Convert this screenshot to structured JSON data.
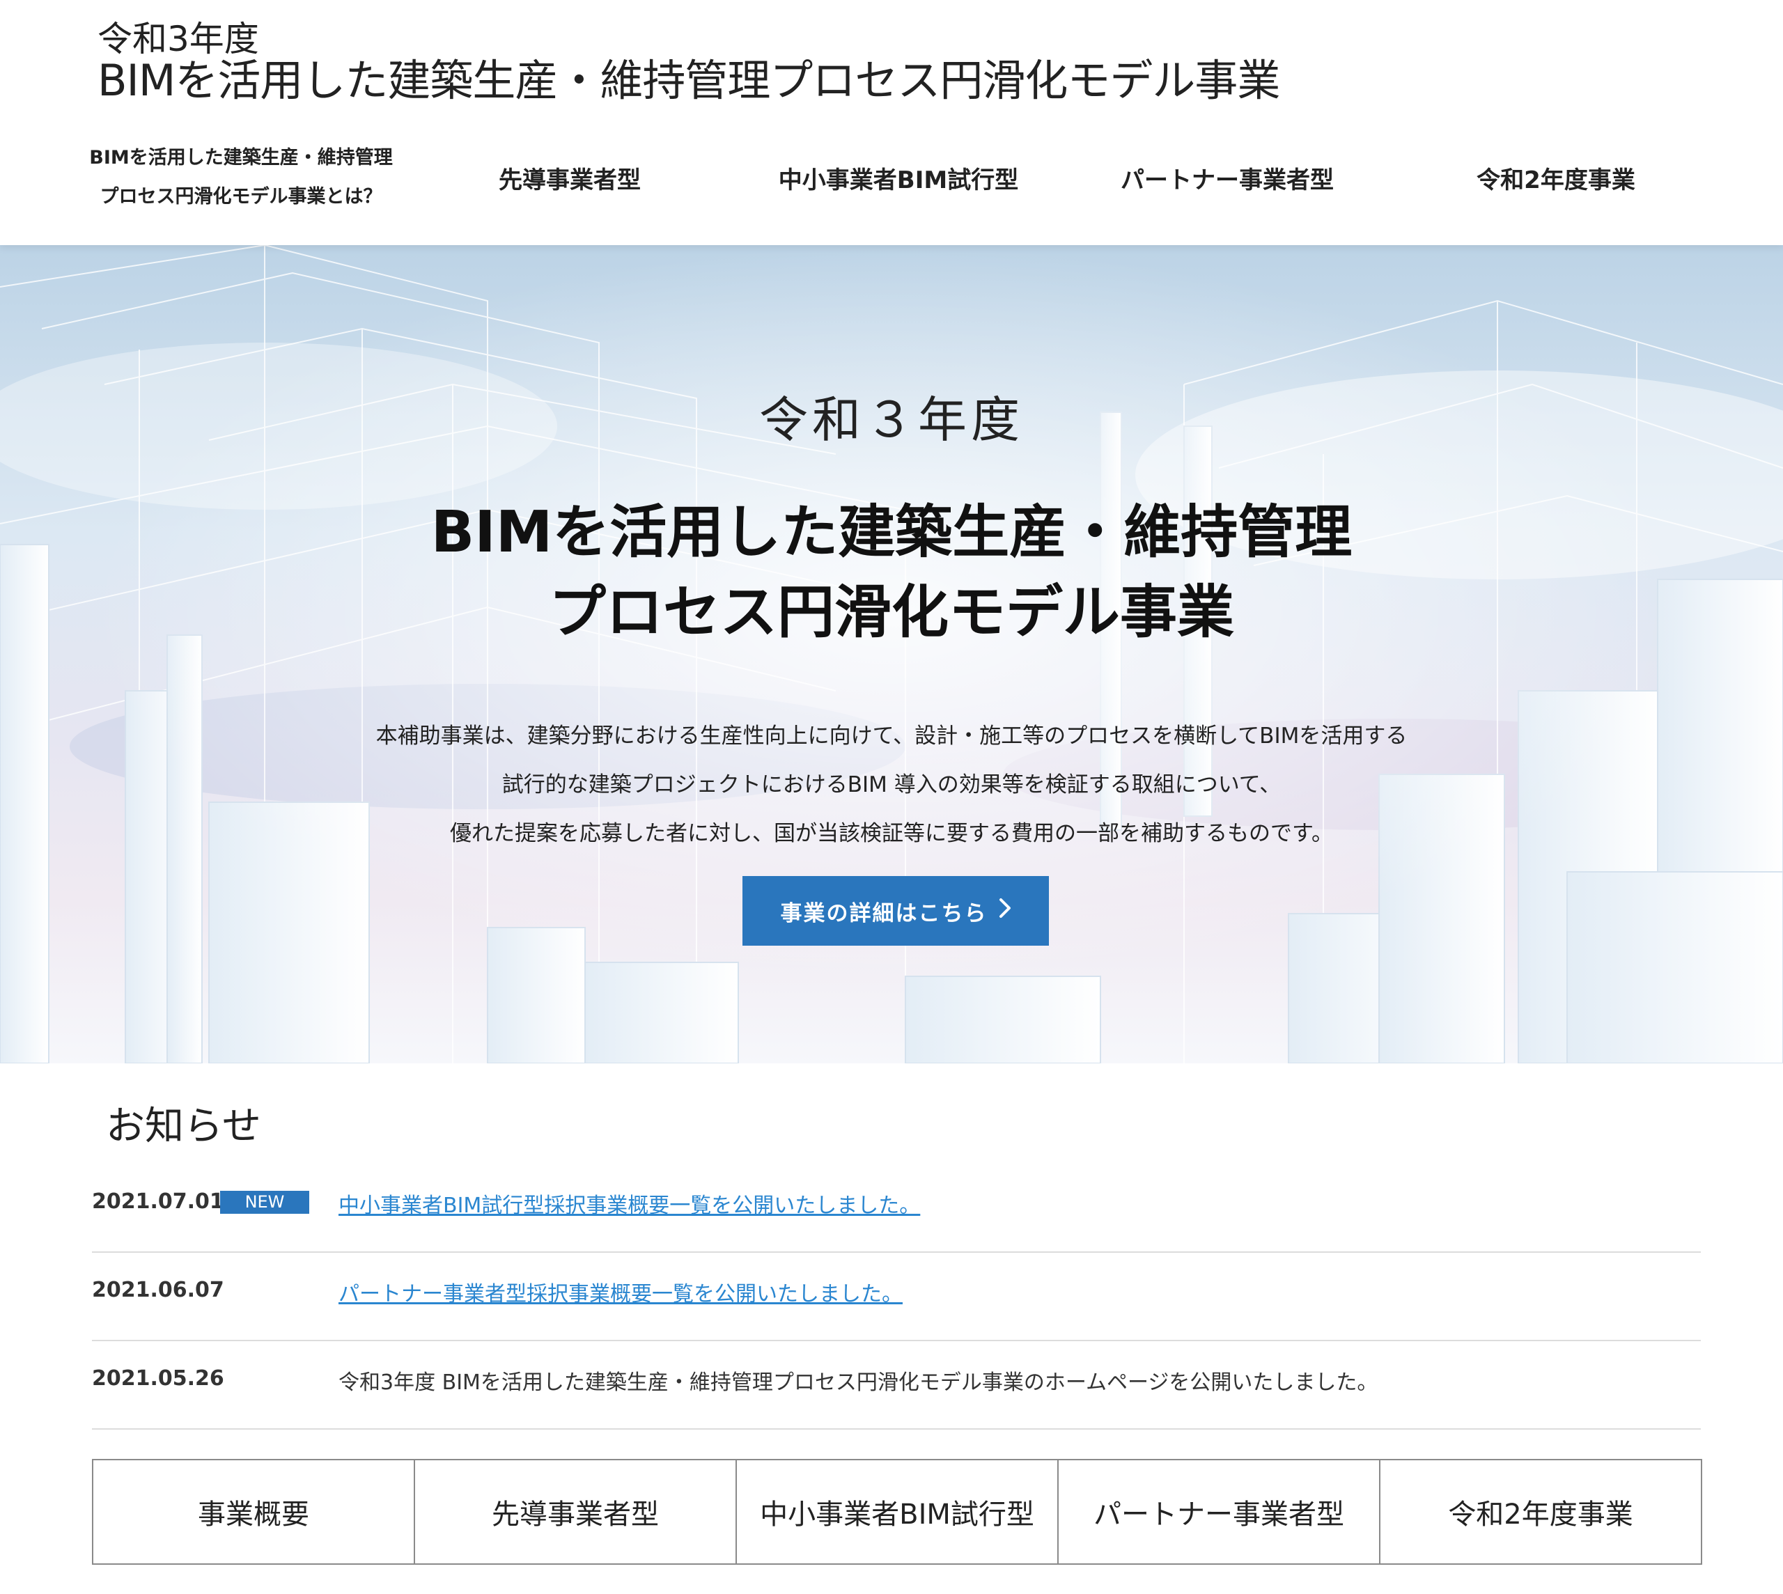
{
  "header": {
    "title_year": "令和3年度",
    "title_main": "BIMを活用した建築生産・維持管理プロセス円滑化モデル事業",
    "nav": [
      {
        "label": "BIMを活用した建築生産・維持管理\nプロセス円滑化モデル事業とは？"
      },
      {
        "label": "先導事業者型"
      },
      {
        "label": "中小事業者BIM試行型"
      },
      {
        "label": "パートナー事業者型"
      },
      {
        "label": "令和2年度事業"
      }
    ]
  },
  "hero": {
    "year": "令和３年度",
    "title_line1": "BIMを活用した建築生産・維持管理",
    "title_line2": "プロセス円滑化モデル事業",
    "desc_line1": "本補助事業は、建築分野における生産性向上に向けて、設計・施工等のプロセスを横断してBIMを活用する",
    "desc_line2": "試行的な建築プロジェクトにおけるBIM 導入の効果等を検証する取組について、",
    "desc_line3": "優れた提案を応募した者に対し、国が当該検証等に要する費用の一部を補助するものです。",
    "button_label": "事業の詳細はこちら",
    "button_icon": "chevron-right-icon",
    "button_color": "#2a76bd"
  },
  "news": {
    "heading": "お知らせ",
    "items": [
      {
        "date": "2021.07.01",
        "badge": "NEW",
        "text": "中小事業者BIM試行型採択事業概要一覧を公開いたしました。",
        "is_link": true
      },
      {
        "date": "2021.06.07",
        "text": "パートナー事業者型採択事業概要一覧を公開いたしました。",
        "is_link": true
      },
      {
        "date": "2021.05.26",
        "text": "令和3年度 BIMを活用した建築生産・維持管理プロセス円滑化モデル事業のホームページを公開いたしました。",
        "is_link": false
      }
    ],
    "link_color": "#2a86d0"
  },
  "bottom_nav": [
    {
      "label": "事業概要"
    },
    {
      "label": "先導事業者型"
    },
    {
      "label": "中小事業者BIM試行型"
    },
    {
      "label": "パートナー事業者型"
    },
    {
      "label": "令和2年度事業"
    }
  ]
}
